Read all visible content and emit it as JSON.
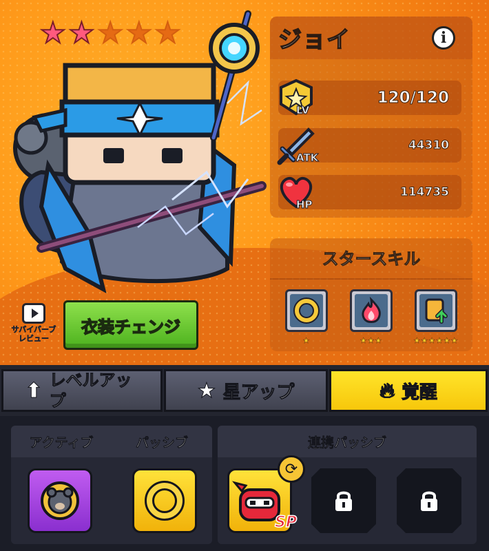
{
  "hero": {
    "name": "ジョイ",
    "stars_filled": 2,
    "stars_total": 5
  },
  "stats": {
    "lv_label": "LV",
    "lv_value": "120/120",
    "atk_label": "ATK",
    "atk_value": "44310",
    "hp_label": "HP",
    "hp_value": "114735"
  },
  "star_skill": {
    "title": "スタースキル",
    "skills": [
      {
        "icon": "ring-skill-icon",
        "stars": "★"
      },
      {
        "icon": "flame-skill-icon",
        "stars": "★★★"
      },
      {
        "icon": "scroll-up-skill-icon",
        "stars": "★★★★★★"
      }
    ]
  },
  "review": {
    "label": "サバイバーブレビュー"
  },
  "costume_button": "衣装チェンジ",
  "tabs": [
    {
      "label": "レベルアップ",
      "icon": "up-arrow-icon"
    },
    {
      "label": "星アップ",
      "icon": "star-icon"
    },
    {
      "label": "覚醒",
      "icon": "flame-icon",
      "active": true
    }
  ],
  "skills_area": {
    "active_label": "アクティブ",
    "passive_label": "パッシブ",
    "link_passive_label": "連携パッシブ",
    "sp_badge": "SP"
  },
  "colors": {
    "accent": "#ffd21a",
    "star_on": "#ff5a7e",
    "button_green": "#5cc224"
  }
}
